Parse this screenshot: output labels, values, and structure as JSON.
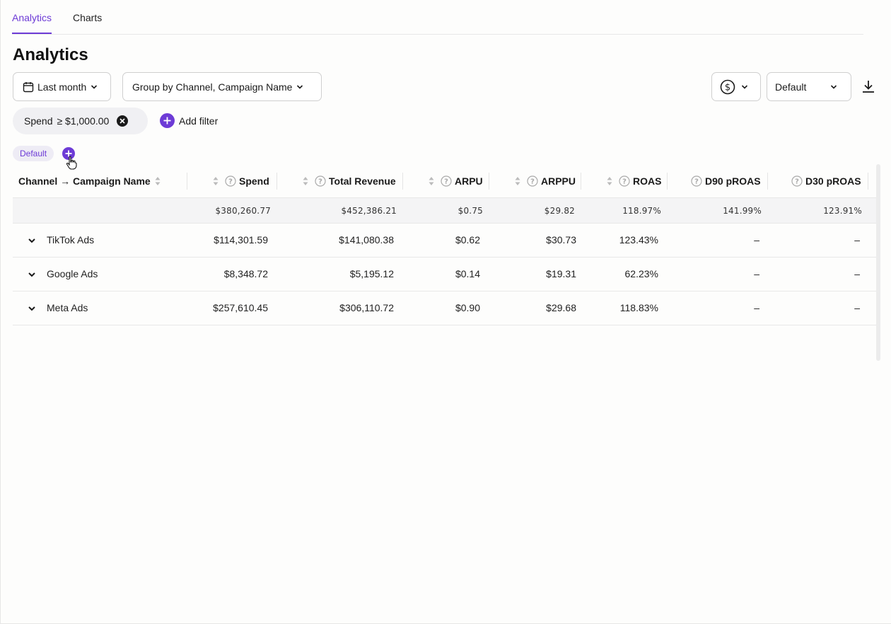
{
  "tabs": [
    {
      "label": "Analytics",
      "active": true
    },
    {
      "label": "Charts",
      "active": false
    }
  ],
  "page_title": "Analytics",
  "toolbar": {
    "date_range": "Last month",
    "group_by": "Group by Channel, Campaign Name",
    "currency_icon": "dollar-circle-icon",
    "view_select": "Default",
    "download_icon": "download-icon"
  },
  "filters": [
    {
      "field": "Spend",
      "value": "≥ $1,000.00"
    }
  ],
  "add_filter_label": "Add filter",
  "saved_view": "Default",
  "table": {
    "columns": [
      "Channel → Campaign Name",
      "Spend",
      "Total Revenue",
      "ARPU",
      "ARPPU",
      "ROAS",
      "D90 pROAS",
      "D30 pROAS"
    ],
    "totals": [
      "",
      "$380,260.77",
      "$452,386.21",
      "$0.75",
      "$29.82",
      "118.97%",
      "141.99%",
      "123.91%"
    ],
    "rows": [
      {
        "name": "TikTok Ads",
        "values": [
          "$114,301.59",
          "$141,080.38",
          "$0.62",
          "$30.73",
          "123.43%",
          "–",
          "–"
        ]
      },
      {
        "name": "Google Ads",
        "values": [
          "$8,348.72",
          "$5,195.12",
          "$0.14",
          "$19.31",
          "62.23%",
          "–",
          "–"
        ]
      },
      {
        "name": "Meta Ads",
        "values": [
          "$257,610.45",
          "$306,110.72",
          "$0.90",
          "$29.68",
          "118.83%",
          "–",
          "–"
        ]
      }
    ]
  },
  "colors": {
    "accent": "#6d3bd6",
    "text": "#1a1a1a",
    "border": "#cfcfcf"
  }
}
